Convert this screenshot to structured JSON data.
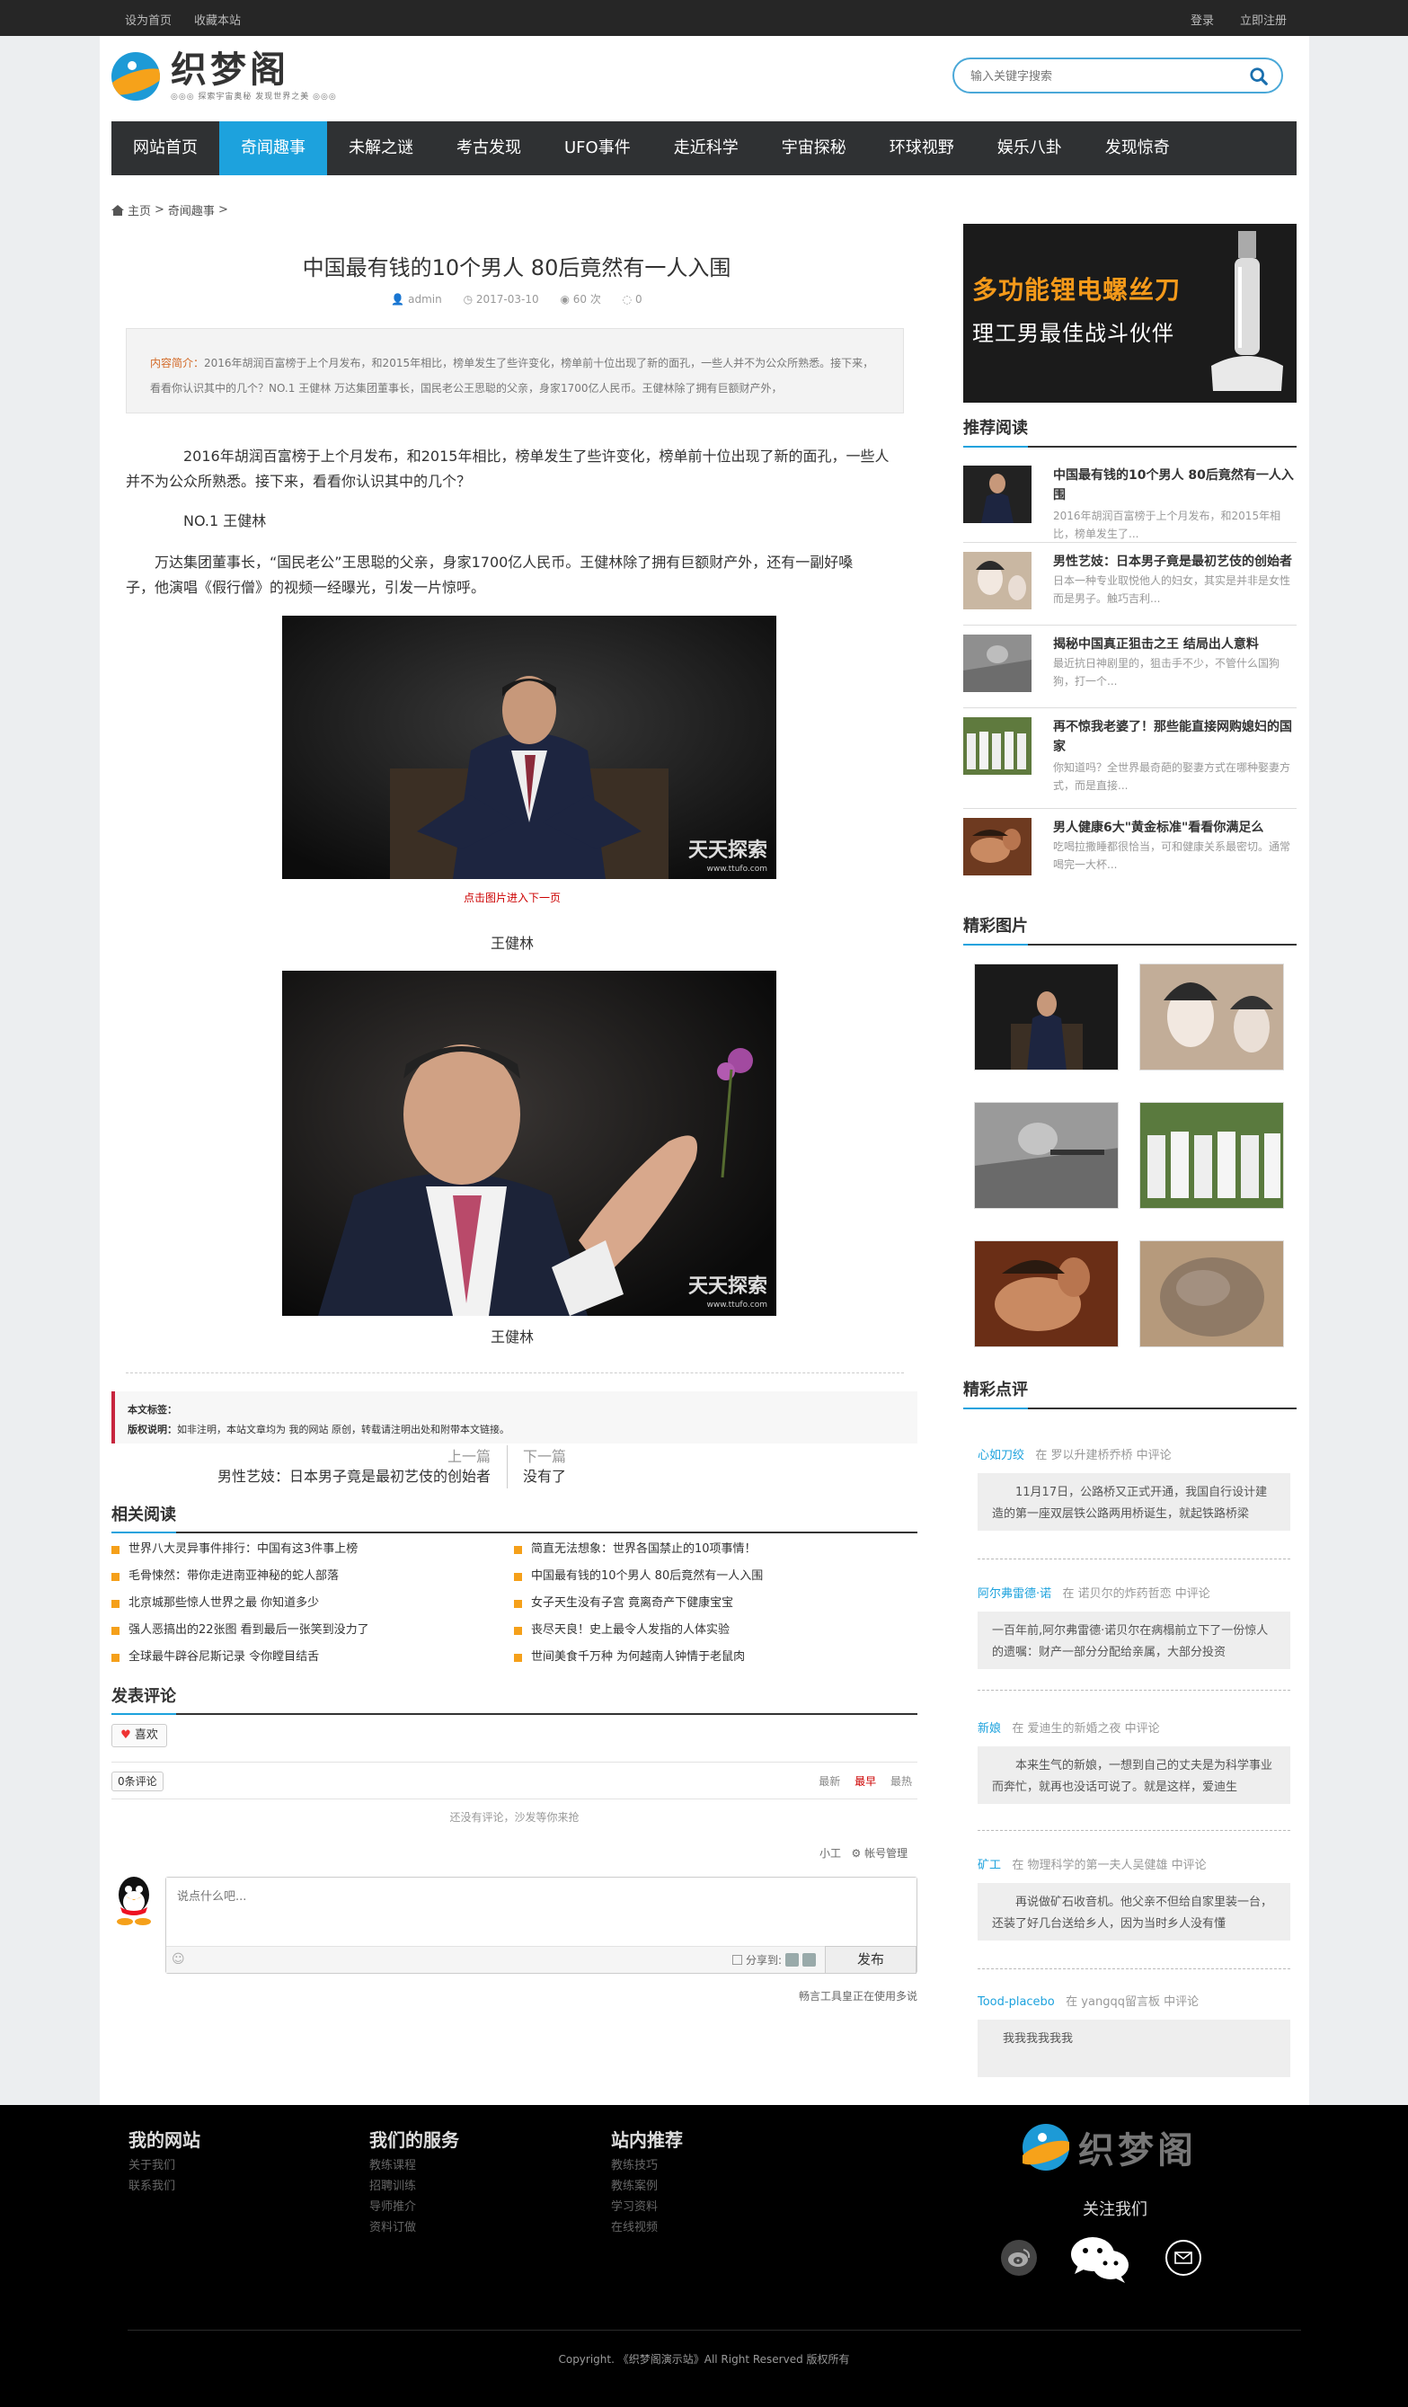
{
  "topbar": {
    "set_home": "设为首页",
    "bookmark": "收藏本站",
    "login": "登录",
    "register": "立即注册"
  },
  "logo": {
    "text": "织梦阁",
    "tagline": "◎◎◎ 探索宇宙奥秘 发现世界之美 ◎◎◎"
  },
  "search": {
    "placeholder": "输入关键字搜索"
  },
  "nav": [
    "网站首页",
    "奇闻趣事",
    "未解之谜",
    "考古发现",
    "UFO事件",
    "走近科学",
    "宇宙探秘",
    "环球视野",
    "娱乐八卦",
    "发现惊奇"
  ],
  "breadcrumb": {
    "home": "主页",
    "sep": ">",
    "current": "奇闻趣事"
  },
  "article": {
    "title": "中国最有钱的10个男人 80后竟然有一人入围",
    "author": "admin",
    "date": "2017-03-10",
    "views": "60 次",
    "comments": "0",
    "summary_label": "内容简介：",
    "summary": "2016年胡润百富榜于上个月发布，和2015年相比，榜单发生了些许变化，榜单前十位出现了新的面孔，一些人并不为公众所熟悉。接下来，看看你认识其中的几个？NO.1 王健林 万达集团董事长，国民老公王思聪的父亲，身家1700亿人民币。王健林除了拥有巨额财产外，",
    "p1": "2016年胡润百富榜于上个月发布，和2015年相比，榜单发生了些许变化，榜单前十位出现了新的面孔，一些人并不为公众所熟悉。接下来，看看你认识其中的几个？",
    "p2": "NO.1 王健林",
    "p3": "万达集团董事长，“国民老公”王思聪的父亲，身家1700亿人民币。王健林除了拥有巨额财产外，还有一副好嗓子，他演唱《假行僧》的视频一经曝光，引发一片惊呼。",
    "click_next": "点击图片进入下一页",
    "caption1": "王健林",
    "caption2": "王健林",
    "watermark": "天天探索",
    "watermark_url": "www.ttufo.com",
    "tags_label": "本文标签：",
    "copyright_label": "版权说明：",
    "copyright": "如非注明，本站文章均为 我的网站 原创，转载请注明出处和附带本文链接。",
    "prev_label": "上一篇",
    "prev_title": "男性艺妓：日本男子竟是最初艺伎的创始者",
    "next_label": "下一篇",
    "next_title": "没有了"
  },
  "related": {
    "title": "相关阅读",
    "left": [
      "世界八大灵异事件排行：中国有这3件事上榜",
      "毛骨悚然：带你走进南亚神秘的蛇人部落",
      "北京城那些惊人世界之最 你知道多少",
      "强人恶搞出的22张图 看到最后一张笑到没力了",
      "全球最牛辟谷尼斯记录 令你瞠目结舌"
    ],
    "right": [
      "简直无法想象：世界各国禁止的10项事情！",
      "中国最有钱的10个男人 80后竟然有一人入围",
      "女子天生没有子宫 竟离奇产下健康宝宝",
      "丧尽天良！史上最令人发指的人体实验",
      "世间美食千万种 为何越南人钟情于老鼠肉"
    ]
  },
  "comments": {
    "title": "发表评论",
    "like": "喜欢",
    "count": "0条评论",
    "sort": [
      "最新",
      "最早",
      "最热"
    ],
    "empty": "还没有评论，沙发等你来抢",
    "user": "小工",
    "account": "帐号管理",
    "placeholder": "说点什么吧...",
    "share": "分享到:",
    "publish": "发布",
    "powered": "畅言工具皇正在使用多说"
  },
  "sidebar": {
    "ad_line1": "多功能锂电螺丝刀",
    "ad_line2": "理工男最佳战斗伙伴",
    "rec_title": "推荐阅读",
    "rec": [
      {
        "title": "中国最有钱的10个男人 80后竟然有一人入围",
        "desc": "2016年胡润百富榜于上个月发布，和2015年相比，榜单发生了..."
      },
      {
        "title": "男性艺妓：日本男子竟是最初艺伎的创始者",
        "desc": "日本一种专业取悦他人的妇女，其实是并非是女性而是男子。触巧吉利..."
      },
      {
        "title": "揭秘中国真正狙击之王 结局出人意料",
        "desc": "最近抗日神剧里的，狙击手不少，不管什么国狗狗，打一个..."
      },
      {
        "title": "再不惊我老婆了！那些能直接网购媳妇的国家",
        "desc": "你知道吗？全世界最奇葩的娶妻方式在哪种娶妻方式，而是直接..."
      },
      {
        "title": "男人健康6大\"黄金标准\"看看你满足么",
        "desc": "吃喝拉撒睡都很恰当，可和健康关系最密切。通常喝完一大杯..."
      }
    ],
    "pics_title": "精彩图片",
    "cmt_title": "精彩点评",
    "cmts": [
      {
        "name": "心如刀绞",
        "where": "在 罗以升建桥乔桥 中评论",
        "text": "11月17日，公路桥又正式开通，我国自行设计建造的第一座双层铁公路两用桥诞生，就起铁路桥梁"
      },
      {
        "name": "阿尔弗雷德·诺",
        "where": "在 诺贝尔的炸药哲恋 中评论",
        "text": "一百年前,阿尔弗雷德·诺贝尔在病榻前立下了一份惊人的遗嘱：财产一部分分配给亲属，大部分投资"
      },
      {
        "name": "新娘",
        "where": "在 爱迪生的新婚之夜 中评论",
        "text": "本来生气的新娘，一想到自己的丈夫是为科学事业而奔忙，就再也没话可说了。就是这样，爱迪生"
      },
      {
        "name": "矿工",
        "where": "在 物理科学的第一夫人吴健雄 中评论",
        "text": "再说做矿石收音机。他父亲不但给自家里装一台，还装了好几台送给乡人，因为当时乡人没有懂"
      },
      {
        "name": "Tood-placebo",
        "where": "在 yangqq留言板 中评论",
        "text": "我我我我我我"
      }
    ]
  },
  "footer": {
    "col1": {
      "title": "我的网站",
      "links": [
        "关于我们",
        "联系我们"
      ]
    },
    "col2": {
      "title": "我们的服务",
      "links": [
        "教练课程",
        "招聘训练",
        "导师推介",
        "资料订做"
      ]
    },
    "col3": {
      "title": "站内推荐",
      "links": [
        "教练技巧",
        "教练案例",
        "学习资料",
        "在线视频"
      ]
    },
    "logo": "织梦阁",
    "follow": "关注我们",
    "copyright": "Copyright. 《织梦阁演示站》All Right Reserved 版权所有"
  },
  "colors": {
    "accent": "#1da2dd",
    "nav_bg": "#2f3133",
    "orange": "#f5a01a",
    "red": "#c7253e"
  }
}
